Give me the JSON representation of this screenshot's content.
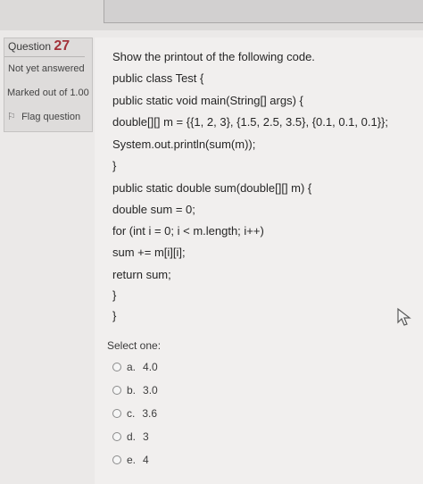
{
  "question": {
    "label": "Question",
    "number": "27",
    "state": "Not yet answered",
    "grade": "Marked out of 1.00",
    "flag_label": "Flag question"
  },
  "code": {
    "lines": [
      "Show the printout of the following code.",
      "public class Test {",
      "public static void main(String[] args) {",
      "double[][] m = {{1, 2, 3}, {1.5, 2.5, 3.5}, {0.1, 0.1, 0.1}};",
      "System.out.println(sum(m));",
      "}",
      "public static double sum(double[][] m) {",
      "double sum = 0;",
      "for (int i = 0; i < m.length; i++)",
      "sum += m[i][i];",
      "return sum;",
      "}",
      "}"
    ]
  },
  "answers": {
    "prompt": "Select one:",
    "options": [
      {
        "letter": "a.",
        "value": "4.0"
      },
      {
        "letter": "b.",
        "value": "3.0"
      },
      {
        "letter": "c.",
        "value": "3.6"
      },
      {
        "letter": "d.",
        "value": "3"
      },
      {
        "letter": "e.",
        "value": "4"
      }
    ]
  },
  "icons": {
    "flag": "flag-icon",
    "cursor": "mouse-pointer-icon",
    "radio": "radio-button-icon"
  }
}
